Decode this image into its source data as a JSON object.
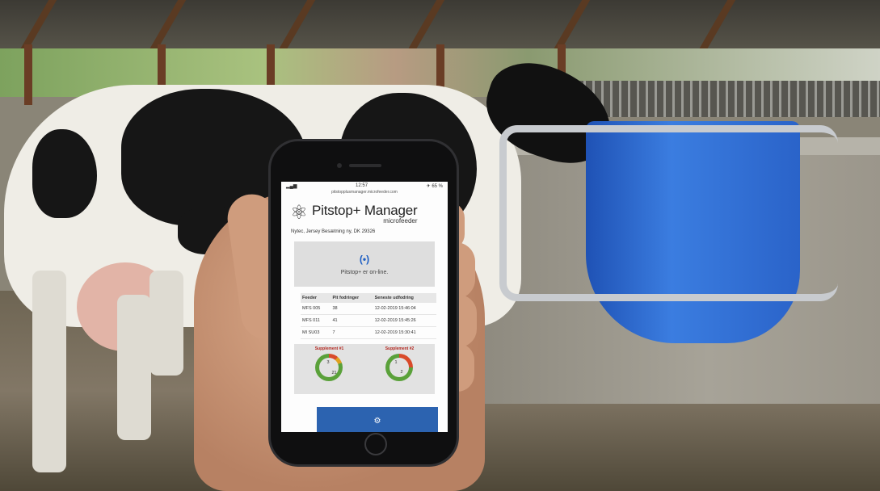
{
  "app": {
    "brand_name": "Pitstop+ Manager",
    "brand_sub": "microfeeder",
    "status_time": "12:57",
    "status_battery": "✈ 65 %",
    "url": "pitstopplusmanager.microfeeder.com",
    "farm_name": "Nytec, Jersey Besætning ny, DK 29326"
  },
  "status_panel": {
    "icon": "signal-icon",
    "text": "Pitstop+ er on-line."
  },
  "feeder_table": {
    "headers": [
      "Feeder",
      "Pit fodringer",
      "Seneste udfodring"
    ],
    "rows": [
      [
        "MFS 005",
        "38",
        "12-02-2019 15:46:04"
      ],
      [
        "MFS 011",
        "41",
        "12-02-2019 15:45:26"
      ],
      [
        "MI SU03",
        "7",
        "12-02-2019 15:30:41"
      ]
    ]
  },
  "supplements": [
    {
      "title": "Supplement #1",
      "top_value": "3",
      "bottom_value": "21",
      "color_main": "#5aa13a",
      "color_accent": "#d94a2a"
    },
    {
      "title": "Supplement #2",
      "top_value": "1",
      "bottom_value": "2",
      "color_main": "#5aa13a",
      "color_accent": "#d94a2a"
    }
  ],
  "colors": {
    "accent_blue": "#2c63b0",
    "feeder_blue": "#2a63c9"
  },
  "icons": {
    "logo": "atom-icon",
    "bottom_button": "feeder-icon"
  }
}
